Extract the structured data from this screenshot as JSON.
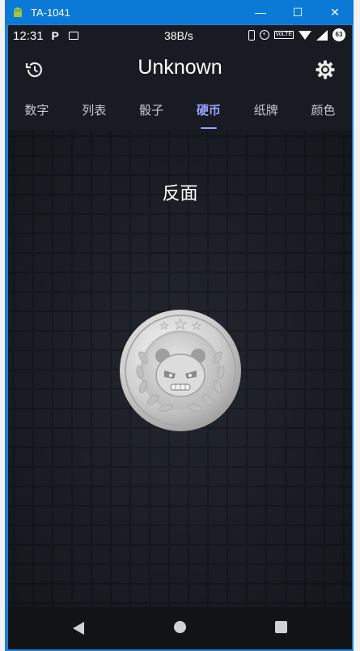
{
  "window": {
    "title": "TA-1041",
    "minimize": "—",
    "maximize": "☐",
    "close": "✕"
  },
  "statusbar": {
    "time": "12:31",
    "app_icon": "P",
    "speed": "38B/s",
    "volte": "VoLTE",
    "battery": "63"
  },
  "appbar": {
    "title": "Unknown",
    "left_icon": "history-icon",
    "right_icon": "gear-icon"
  },
  "tabs": [
    {
      "label": "数字"
    },
    {
      "label": "列表"
    },
    {
      "label": "骰子"
    },
    {
      "label": "硬币",
      "active": true
    },
    {
      "label": "纸牌"
    },
    {
      "label": "颜色"
    }
  ],
  "result": {
    "text": "反面"
  },
  "colors": {
    "accent": "#9aa2ff",
    "background": "#181b21",
    "titlebar": "#0b7ad6"
  }
}
